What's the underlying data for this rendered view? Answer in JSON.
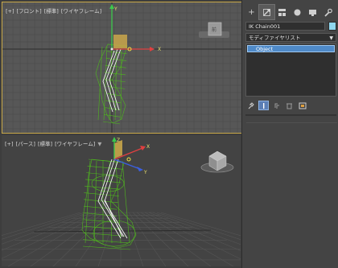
{
  "viewports": {
    "front": {
      "plus": "[+]",
      "view": "[フロント]",
      "shading": "[標準]",
      "mode": "[ワイヤフレーム]"
    },
    "perspective": {
      "plus": "[+]",
      "view": "[パース]",
      "shading": "[標準]",
      "mode": "[ワイヤフレーム]"
    }
  },
  "viewcube": {
    "front_label": "前"
  },
  "command_panel": {
    "tabs": [
      {
        "icon": "plus-icon",
        "glyph": "+"
      },
      {
        "icon": "modify-icon",
        "glyph": "⟋"
      },
      {
        "icon": "hierarchy-icon",
        "glyph": "▤"
      },
      {
        "icon": "motion-icon",
        "glyph": "●"
      },
      {
        "icon": "display-icon",
        "glyph": "▬"
      },
      {
        "icon": "utilities-icon",
        "glyph": "🔧"
      }
    ],
    "object_name": "IK Chain001",
    "object_color": "#8fd6ee",
    "modifier_list": "モディファイヤリスト",
    "stack_items": [
      "Object"
    ]
  },
  "colors": {
    "accent": "#c8a848",
    "wire": "#4fb81e",
    "selection": "#4f8ac8"
  }
}
